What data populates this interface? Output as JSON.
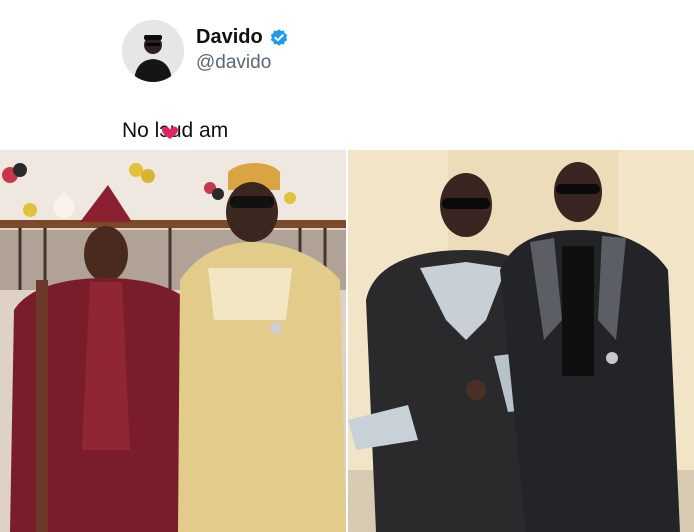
{
  "post": {
    "display_name": "Davido",
    "handle": "@davido",
    "verified": true,
    "text": "No lɔud am",
    "text_overlay_icon": "red-heart-icon"
  },
  "media": [
    {
      "icon": "photo-traditional-attire"
    },
    {
      "icon": "photo-black-suits"
    }
  ],
  "colors": {
    "verified_blue": "#1d9bf0",
    "heart_red": "#e0245e"
  }
}
